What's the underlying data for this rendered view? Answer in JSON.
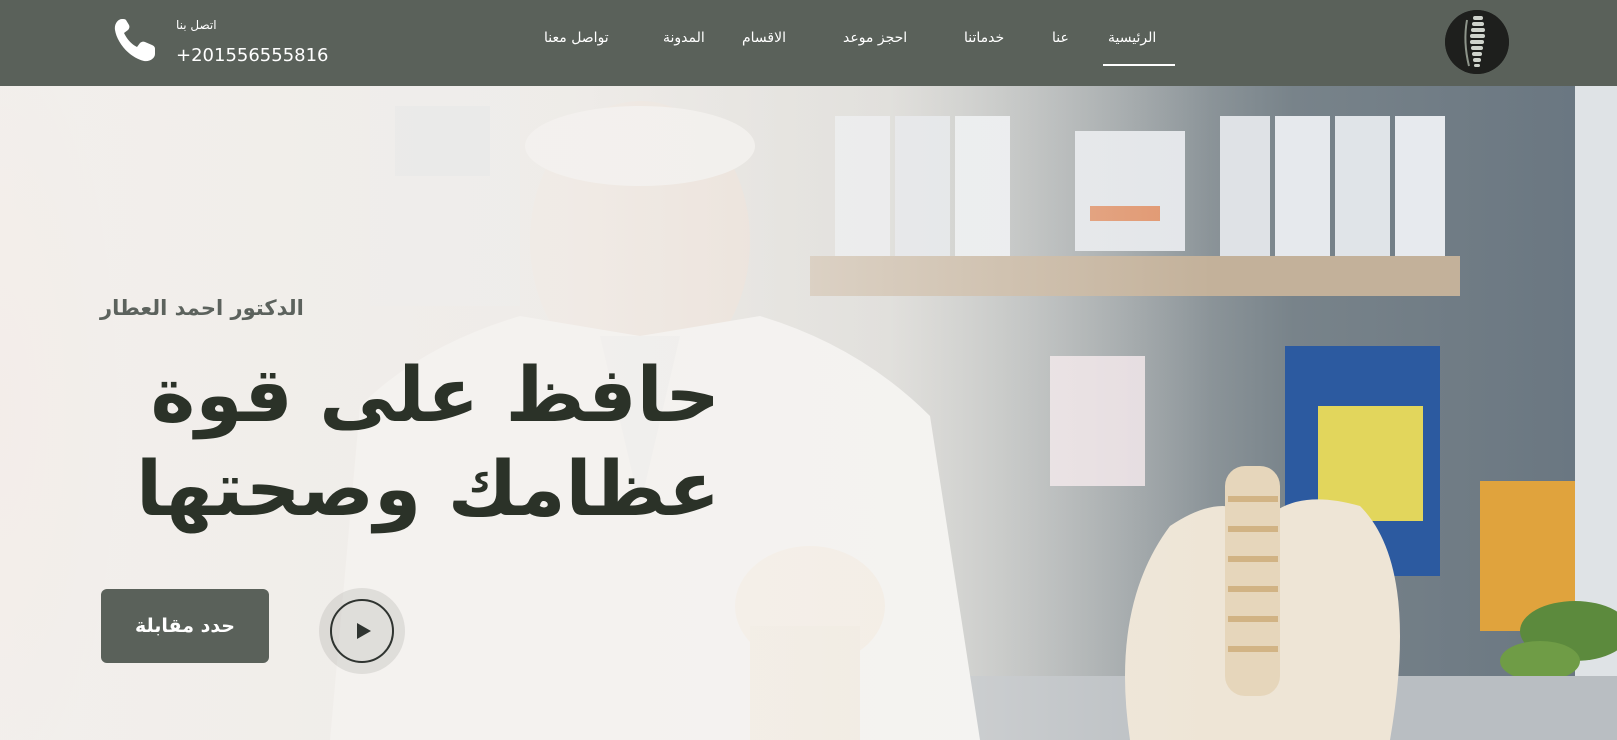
{
  "header": {
    "nav": [
      {
        "label": "الرئيسية",
        "active": true
      },
      {
        "label": "عنا"
      },
      {
        "label": "خدماتنا"
      },
      {
        "label": "احجز موعد"
      },
      {
        "label": "الاقسام"
      },
      {
        "label": "المدونة"
      },
      {
        "label": "تواصل معنا"
      }
    ],
    "call_label": "اتصل بنا",
    "phone_number": "+201556555816",
    "icons": {
      "logo": "spine-logo-icon",
      "phone": "phone-icon"
    }
  },
  "hero": {
    "doctor_name": "الدكتور احمد العطار",
    "headline": "حافظ على قوة عظامك وصحتها",
    "book_button": "حدد مقابلة",
    "play_icon": "play-icon",
    "background": "doctor-with-spine-model-photo"
  },
  "colors": {
    "header_bg": "#5a615a",
    "headline": "#2b3228",
    "button_bg": "#5a615a",
    "text_light": "#ffffff"
  }
}
